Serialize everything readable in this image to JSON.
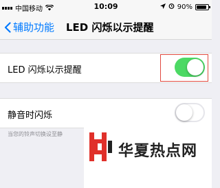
{
  "status_bar": {
    "carrier": "中国移动",
    "time": "10:09",
    "battery": "90%",
    "battery_level": 0.9
  },
  "nav": {
    "back_label": "辅助功能",
    "title": "LED 闪烁以示提醒"
  },
  "settings": {
    "led_flash": {
      "label": "LED 闪烁以示提醒",
      "enabled": true
    },
    "flash_on_silent": {
      "label": "静音时闪烁",
      "enabled": false
    },
    "footer": "当您的铃声切换设至静"
  },
  "watermark": {
    "text": "华夏热点网"
  },
  "colors": {
    "accent": "#007aff",
    "toggle_on": "#4cd964",
    "highlight_border": "#e0483e"
  }
}
